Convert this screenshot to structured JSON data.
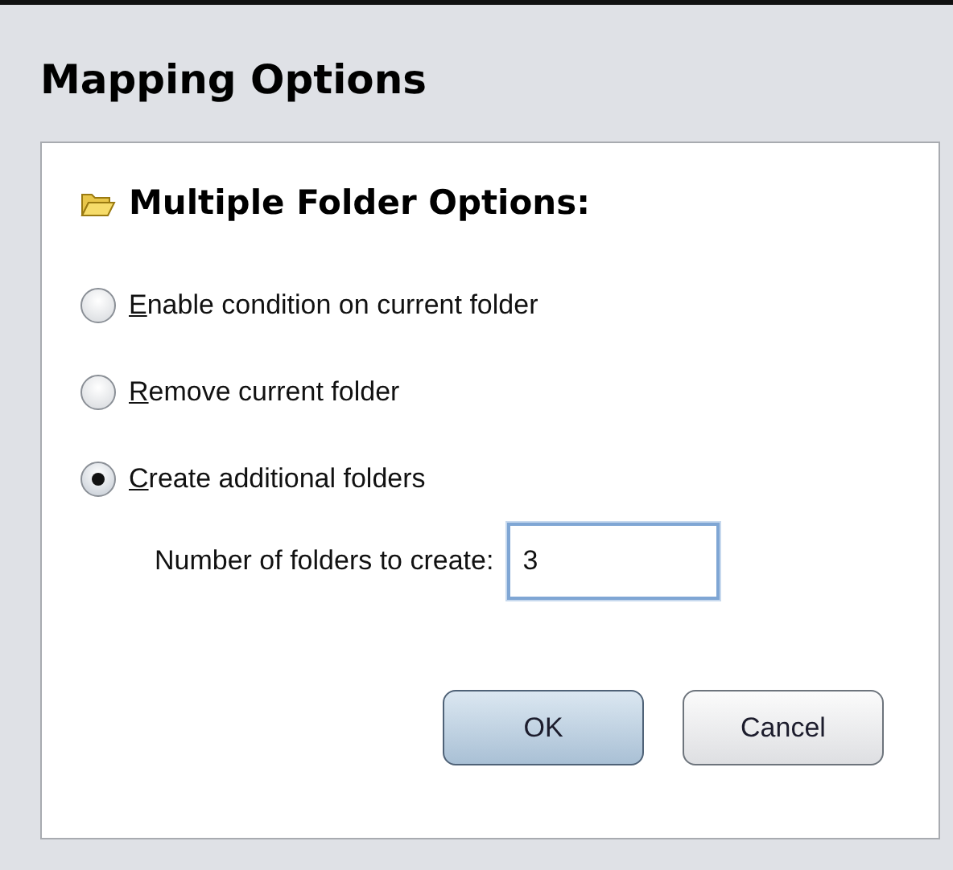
{
  "window": {
    "title": "Mapping Options"
  },
  "section": {
    "title": "Multiple Folder Options:"
  },
  "options": [
    {
      "label": "Enable condition on current folder",
      "selected": false,
      "mnemonic_underlined": true
    },
    {
      "label": "Remove current folder",
      "selected": false,
      "mnemonic_underlined": true
    },
    {
      "label": "Create additional folders",
      "selected": true,
      "mnemonic_underlined": true
    }
  ],
  "folder_count": {
    "label": "Number of folders to create:",
    "value": "3",
    "focused": true
  },
  "buttons": [
    {
      "label": "OK",
      "default": true
    },
    {
      "label": "Cancel",
      "default": false
    }
  ]
}
